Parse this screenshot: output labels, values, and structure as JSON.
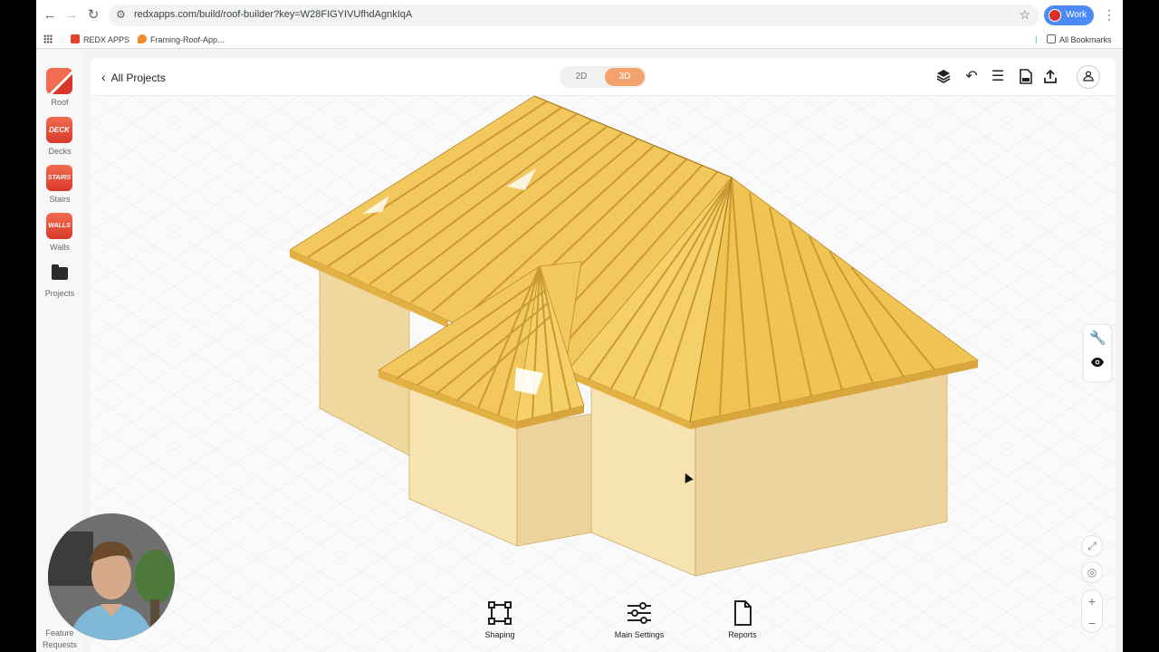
{
  "browser": {
    "url": "redxapps.com/build/roof-builder?key=W28FIGYIVUfhdAgnkIqA",
    "profile_label": "Work",
    "bookmarks": [
      "REDX APPS",
      "Framing-Roof-App..."
    ],
    "all_bookmarks": "All Bookmarks"
  },
  "sidebar": {
    "items": [
      {
        "label": "Roof",
        "tile": ""
      },
      {
        "label": "Decks",
        "tile": "DECK"
      },
      {
        "label": "Stairs",
        "tile": "STAIRS"
      },
      {
        "label": "Walls",
        "tile": "WALLS"
      },
      {
        "label": "Projects",
        "tile": ""
      }
    ],
    "feature_requests": "Feature Requests"
  },
  "topbar": {
    "back_label": "All Projects",
    "modes": [
      "2D",
      "3D"
    ],
    "active_mode": "3D"
  },
  "bottom_tools": [
    "Shaping",
    "Main Settings",
    "Reports"
  ],
  "colors": {
    "accent": "#f4a26c",
    "roof_top": "#f2c85c",
    "roof_edge": "#e3b044",
    "wall_light": "#f7e3b0",
    "wall_dark": "#ecd49c",
    "brand_red": "#e0442f"
  }
}
